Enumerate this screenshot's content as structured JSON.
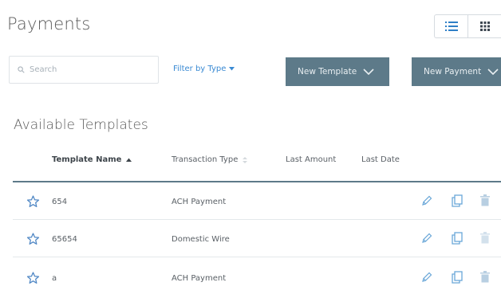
{
  "header": {
    "title": "Payments",
    "view_icons": [
      "list-view-icon",
      "grid-view-icon"
    ]
  },
  "toolbar": {
    "search_placeholder": "Search",
    "filter_label": "Filter by Type",
    "new_template_label": "New Template",
    "new_payment_label": "New Payment"
  },
  "section": {
    "title": "Available Templates"
  },
  "table": {
    "columns": [
      "Template Name",
      "Transaction Type",
      "Last Amount",
      "Last Date"
    ],
    "rows": [
      {
        "name": "654",
        "type": "ACH Payment",
        "amount": "",
        "date": ""
      },
      {
        "name": "65654",
        "type": "Domestic Wire",
        "amount": "",
        "date": ""
      },
      {
        "name": "a",
        "type": "ACH Payment",
        "amount": "",
        "date": ""
      }
    ]
  },
  "colors": {
    "accent": "#5d7a89",
    "link": "#3a8ad3",
    "icon": "#6aa7d8"
  }
}
